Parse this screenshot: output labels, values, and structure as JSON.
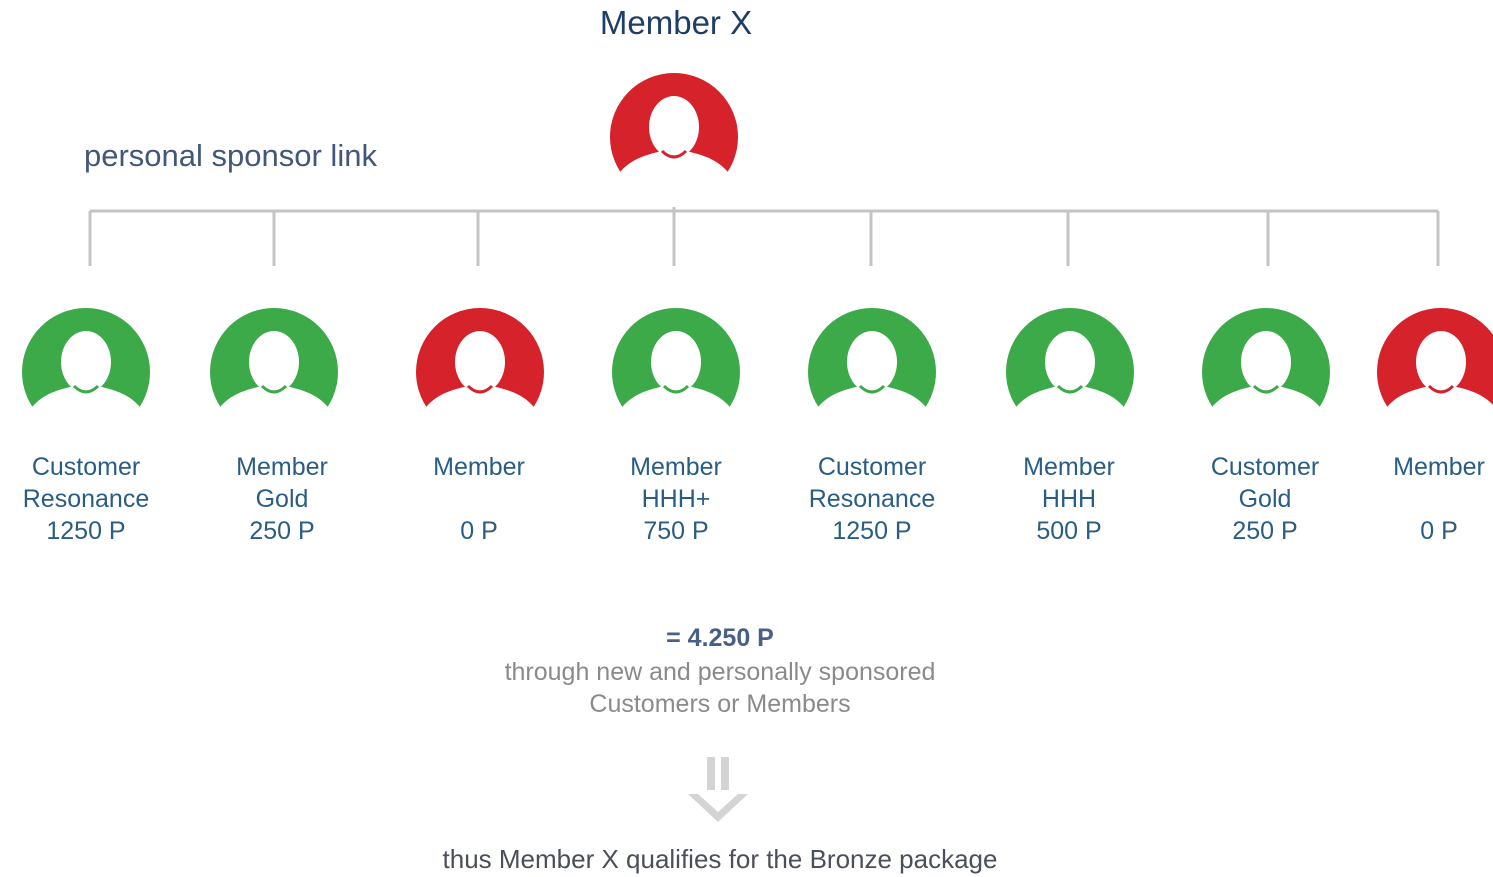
{
  "title": "Member X",
  "link_label": "personal sponsor link",
  "colors": {
    "qualified": "#3daa4a",
    "unqualified": "#d5222b",
    "connector": "#c4c4c4",
    "arrow": "#d4d4d4"
  },
  "root": {
    "status": "unqualified",
    "icon": "person-avatar-icon"
  },
  "members": [
    {
      "line1": "Customer",
      "line2": "Resonance",
      "points": "1250 P",
      "status": "qualified"
    },
    {
      "line1": "Member",
      "line2": "Gold",
      "points": "250 P",
      "status": "qualified"
    },
    {
      "line1": "Member",
      "line2": "",
      "points": "0 P",
      "status": "unqualified"
    },
    {
      "line1": "Member",
      "line2": "HHH+",
      "points": "750 P",
      "status": "qualified"
    },
    {
      "line1": "Customer",
      "line2": "Resonance",
      "points": "1250 P",
      "status": "qualified"
    },
    {
      "line1": "Member",
      "line2": "HHH",
      "points": "500 P",
      "status": "qualified"
    },
    {
      "line1": "Customer",
      "line2": "Gold",
      "points": "250 P",
      "status": "qualified"
    },
    {
      "line1": "Member",
      "line2": "",
      "points": "0 P",
      "status": "unqualified"
    }
  ],
  "total": "= 4.250 P",
  "note_line1": "through new and personally sponsored",
  "note_line2": "Customers or Members",
  "arrow_icon": "down-arrow-icon",
  "conclusion": "thus Member X qualifies for the Bronze package"
}
